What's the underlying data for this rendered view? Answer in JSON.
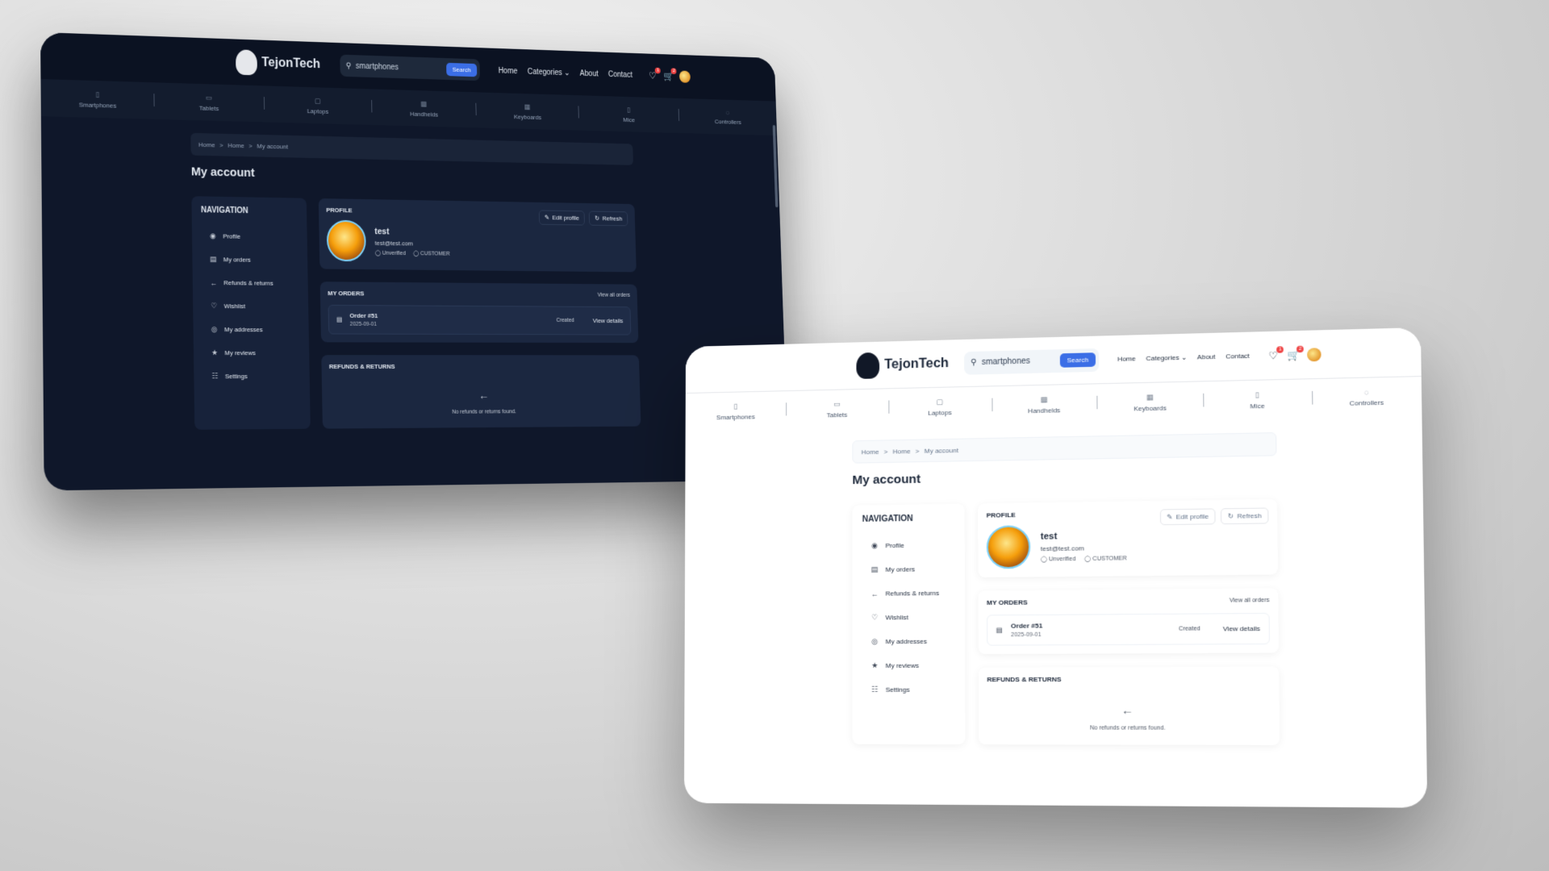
{
  "app": {
    "brand": "TejonTech",
    "search_value": "smartphones",
    "search_button": "Search",
    "nav": [
      "Home",
      "Categories",
      "About",
      "Contact"
    ],
    "wishlist_count": "1",
    "cart_count": "2"
  },
  "categories": [
    {
      "label": "Smartphones",
      "icon": "phone-icon"
    },
    {
      "label": "Tablets",
      "icon": "tablet-icon"
    },
    {
      "label": "Laptops",
      "icon": "laptop-icon"
    },
    {
      "label": "Handhelds",
      "icon": "gamepad-icon"
    },
    {
      "label": "Keyboards",
      "icon": "keyboard-icon"
    },
    {
      "label": "Mice",
      "icon": "mouse-icon"
    },
    {
      "label": "Controllers",
      "icon": "controller-icon"
    }
  ],
  "breadcrumb": [
    "Home",
    "Home",
    "My account"
  ],
  "page_title": "My account",
  "sidebar": {
    "title": "NAVIGATION",
    "items": [
      {
        "label": "Profile",
        "icon": "user-icon"
      },
      {
        "label": "My orders",
        "icon": "clipboard-icon"
      },
      {
        "label": "Refunds & returns",
        "icon": "arrow-left-icon"
      },
      {
        "label": "Wishlist",
        "icon": "heart-icon"
      },
      {
        "label": "My addresses",
        "icon": "location-icon"
      },
      {
        "label": "My reviews",
        "icon": "star-icon"
      },
      {
        "label": "Settings",
        "icon": "sliders-icon"
      }
    ]
  },
  "profile": {
    "title": "PROFILE",
    "edit_label": "Edit profile",
    "refresh_label": "Refresh",
    "name": "test",
    "email": "test@test.com",
    "verification": "Unverified",
    "role": "CUSTOMER"
  },
  "orders": {
    "title": "MY ORDERS",
    "view_all": "View all orders",
    "rows": [
      {
        "id": "Order #51",
        "date": "2025-09-01",
        "status": "Created",
        "action": "View details"
      }
    ]
  },
  "refunds": {
    "title": "REFUNDS & RETURNS",
    "empty_text": "No refunds or returns found."
  },
  "colors": {
    "dark_bg": "#0f172a",
    "accent": "#3b6ee6",
    "badge": "#ef4444"
  }
}
